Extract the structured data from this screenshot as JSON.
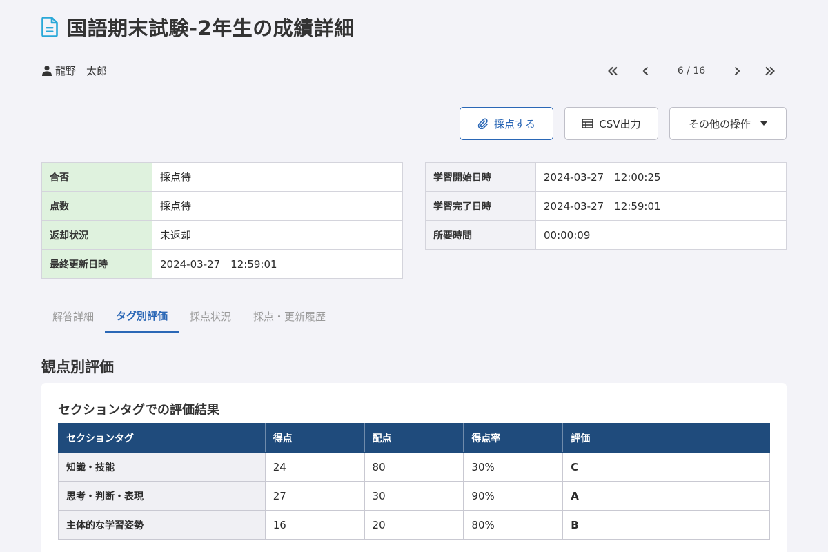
{
  "header": {
    "title": "国語期末試験-2年生の成績詳細",
    "user_name": "龍野　太郎",
    "pager": {
      "current": 6,
      "total": 16,
      "label": "6 / 16"
    }
  },
  "actions": {
    "grade_label": "採点する",
    "csv_label": "CSV出力",
    "more_label": "その他の操作"
  },
  "status_table": [
    {
      "key": "合否",
      "value": "採点待"
    },
    {
      "key": "点数",
      "value": "採点待"
    },
    {
      "key": "返却状況",
      "value": "未返却"
    },
    {
      "key": "最終更新日時",
      "value": "2024-03-27　12:59:01"
    }
  ],
  "time_table": [
    {
      "key": "学習開始日時",
      "value": "2024-03-27　12:00:25"
    },
    {
      "key": "学習完了日時",
      "value": "2024-03-27　12:59:01"
    },
    {
      "key": "所要時間",
      "value": "00:00:09"
    }
  ],
  "tabs": [
    {
      "label": "解答詳細",
      "active": false
    },
    {
      "label": "タグ別評価",
      "active": true
    },
    {
      "label": "採点状況",
      "active": false
    },
    {
      "label": "採点・更新履歴",
      "active": false
    }
  ],
  "section": {
    "title": "観点別評価",
    "card_title": "セクションタグでの評価結果",
    "columns": [
      "セクションタグ",
      "得点",
      "配点",
      "得点率",
      "評価"
    ],
    "rows": [
      {
        "tag": "知識・技能",
        "score": "24",
        "max": "80",
        "rate": "30%",
        "grade": "C"
      },
      {
        "tag": "思考・判断・表現",
        "score": "27",
        "max": "30",
        "rate": "90%",
        "grade": "A"
      },
      {
        "tag": "主体的な学習姿勢",
        "score": "16",
        "max": "20",
        "rate": "80%",
        "grade": "B"
      }
    ]
  },
  "colors": {
    "accent": "#2a67b6",
    "header_bg": "#1f4b7c",
    "pass_key_bg": "#dff2de",
    "doc_icon": "#29a8d8"
  }
}
